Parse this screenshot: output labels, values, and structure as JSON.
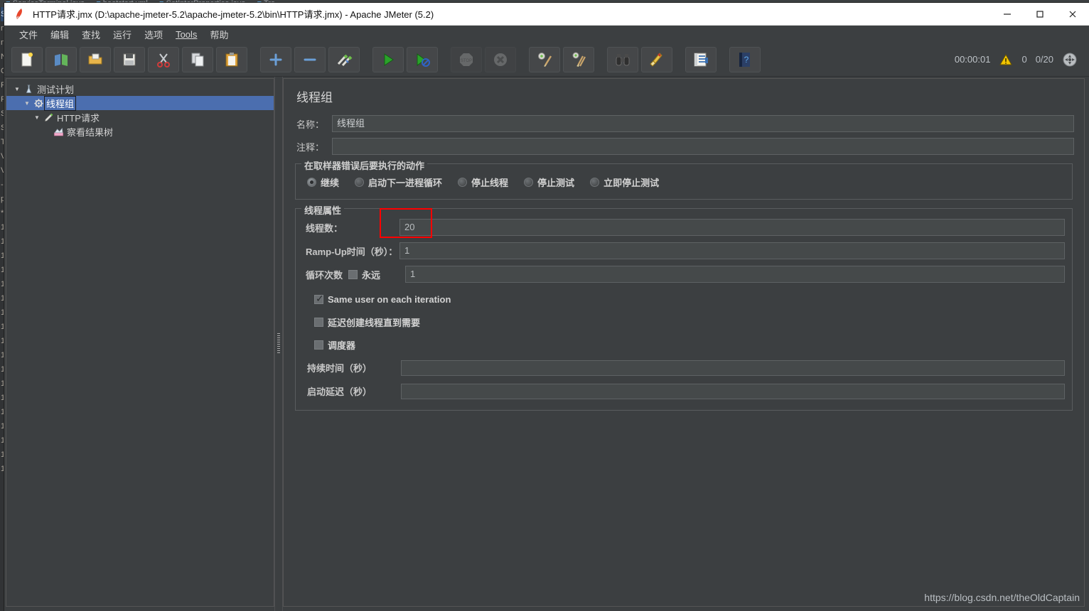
{
  "background": {
    "tabs": [
      {
        "icon": "java-file-icon",
        "label": "ServiceTerminal.java"
      },
      {
        "icon": "xml-file-icon",
        "label": "bootstart.yml"
      },
      {
        "icon": "java-file-icon",
        "label": "SetInterProperties.java"
      },
      {
        "icon": "java-file-icon",
        "label": "Tra"
      }
    ],
    "gutter_lines": [
      "Se",
      "n.c",
      "n.c",
      "Na",
      "Op",
      "Re",
      "Rit",
      "Se",
      "Sw",
      "Te",
      "Va",
      "Va",
      "-",
      "pl",
      "*",
      "1",
      "1",
      "1",
      "1",
      "1",
      "1",
      "1",
      "1",
      "1",
      "1",
      "1",
      "1",
      "1",
      "1",
      "1",
      "1",
      "1",
      "1"
    ]
  },
  "window": {
    "icon": "jmeter-feather-icon",
    "title": "HTTP请求.jmx (D:\\apache-jmeter-5.2\\apache-jmeter-5.2\\bin\\HTTP请求.jmx) - Apache JMeter (5.2)",
    "controls": {
      "minimize": "minimize-icon",
      "maximize": "maximize-icon",
      "close": "close-icon"
    }
  },
  "menubar": {
    "items": [
      {
        "label": "文件",
        "underlined": false
      },
      {
        "label": "编辑",
        "underlined": false
      },
      {
        "label": "查找",
        "underlined": false
      },
      {
        "label": "运行",
        "underlined": false
      },
      {
        "label": "选项",
        "underlined": false
      },
      {
        "label": "Tools",
        "underlined": true
      },
      {
        "label": "帮助",
        "underlined": false
      }
    ]
  },
  "toolbar": {
    "buttons": [
      {
        "name": "new-button",
        "icon": "new-document-icon",
        "disabled": false
      },
      {
        "name": "templates-button",
        "icon": "templates-icon",
        "disabled": false
      },
      {
        "name": "open-button",
        "icon": "open-folder-icon",
        "disabled": false
      },
      {
        "name": "save-button",
        "icon": "save-floppy-icon",
        "disabled": false
      },
      {
        "name": "cut-button",
        "icon": "scissors-icon",
        "disabled": false
      },
      {
        "name": "copy-button",
        "icon": "copy-icon",
        "disabled": false
      },
      {
        "name": "paste-button",
        "icon": "paste-clipboard-icon",
        "disabled": false
      },
      {
        "name": "expand-all-button",
        "icon": "plus-icon",
        "disabled": false
      },
      {
        "name": "collapse-all-button",
        "icon": "minus-icon",
        "disabled": false
      },
      {
        "name": "toggle-button",
        "icon": "toggle-pencils-icon",
        "disabled": false
      },
      {
        "name": "start-button",
        "icon": "green-play-icon",
        "disabled": false
      },
      {
        "name": "start-no-pauses-button",
        "icon": "play-no-pauses-icon",
        "disabled": false
      },
      {
        "name": "stop-button",
        "icon": "stop-sign-icon",
        "disabled": true
      },
      {
        "name": "shutdown-button",
        "icon": "shutdown-x-icon",
        "disabled": true
      },
      {
        "name": "clear-button",
        "icon": "clear-gear-broom-icon",
        "disabled": false
      },
      {
        "name": "clear-all-button",
        "icon": "clear-all-broom-icon",
        "disabled": false
      },
      {
        "name": "search-button",
        "icon": "binoculars-icon",
        "disabled": false
      },
      {
        "name": "reset-search-button",
        "icon": "broom-icon",
        "disabled": false
      },
      {
        "name": "function-helper-button",
        "icon": "function-list-icon",
        "disabled": false
      },
      {
        "name": "help-button",
        "icon": "help-book-icon",
        "disabled": false
      }
    ],
    "status": {
      "timer": "00:00:01",
      "warning_icon": "warning-triangle-icon",
      "warning_count": "0",
      "thread_counter": "0/20",
      "remote_icon": "connection-globe-icon"
    }
  },
  "tree": {
    "nodes": [
      {
        "label": "测试计划",
        "icon": "test-plan-icon",
        "twisty": "▼",
        "indent": 0,
        "selected": false
      },
      {
        "label": "线程组",
        "icon": "thread-group-gear-icon",
        "twisty": "▼",
        "indent": 1,
        "selected": true
      },
      {
        "label": "HTTP请求",
        "icon": "http-sampler-pen-icon",
        "twisty": "▼",
        "indent": 2,
        "selected": false
      },
      {
        "label": "察看结果树",
        "icon": "view-results-tree-icon",
        "twisty": "",
        "indent": 3,
        "selected": false
      }
    ]
  },
  "main": {
    "panel_title": "线程组",
    "name_label": "名称：",
    "name_value": "线程组",
    "comment_label": "注释：",
    "comment_value": "",
    "error_action": {
      "group_title": "在取样器错误后要执行的动作",
      "options": [
        {
          "label": "继续",
          "checked": true
        },
        {
          "label": "启动下一进程循环",
          "checked": false
        },
        {
          "label": "停止线程",
          "checked": false
        },
        {
          "label": "停止测试",
          "checked": false
        },
        {
          "label": "立即停止测试",
          "checked": false
        }
      ]
    },
    "thread_properties": {
      "group_title": "线程属性",
      "threads_label": "线程数：",
      "threads_value": "20",
      "threads_highlighted": true,
      "rampup_label": "Ramp-Up时间（秒）：",
      "rampup_value": "1",
      "loop_label": "循环次数",
      "loop_forever_label": "永远",
      "loop_forever_checked": false,
      "loop_value": "1",
      "same_user_label": "Same user on each iteration",
      "same_user_checked": true,
      "delay_create_label": "延迟创建线程直到需要",
      "delay_create_checked": false,
      "scheduler_label": "调度器",
      "scheduler_checked": false,
      "duration_label": "持续时间（秒）",
      "duration_value": "",
      "startup_delay_label": "启动延迟（秒）",
      "startup_delay_value": ""
    }
  },
  "watermark": "https://blog.csdn.net/theOldCaptain"
}
